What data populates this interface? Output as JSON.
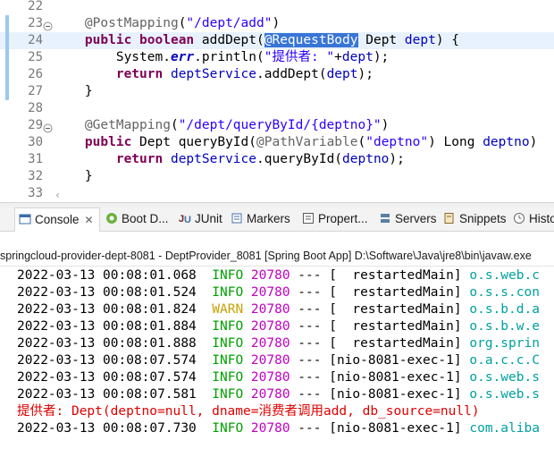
{
  "editor": {
    "lines": [
      {
        "num": "22",
        "tokens": []
      },
      {
        "num": "23",
        "fold": true,
        "tokens": [
          {
            "t": "    "
          },
          {
            "t": "@PostMapping",
            "c": "ann"
          },
          {
            "t": "("
          },
          {
            "t": "\"/dept/add\"",
            "c": "str"
          },
          {
            "t": ")"
          }
        ]
      },
      {
        "num": "24",
        "current": true,
        "tokens": [
          {
            "t": "    "
          },
          {
            "t": "public",
            "c": "kw"
          },
          {
            "t": " "
          },
          {
            "t": "boolean",
            "c": "kw"
          },
          {
            "t": " addDept("
          },
          {
            "t": "@RequestBody",
            "c": "sel"
          },
          {
            "t": " Dept "
          },
          {
            "t": "dept",
            "c": "fld"
          },
          {
            "t": ") {"
          }
        ]
      },
      {
        "num": "25",
        "tokens": [
          {
            "t": "        System."
          },
          {
            "t": "err",
            "c": "stat"
          },
          {
            "t": ".println("
          },
          {
            "t": "\"提供者: \"",
            "c": "str"
          },
          {
            "t": "+"
          },
          {
            "t": "dept",
            "c": "fld"
          },
          {
            "t": ");"
          }
        ]
      },
      {
        "num": "26",
        "tokens": [
          {
            "t": "        "
          },
          {
            "t": "return",
            "c": "kw"
          },
          {
            "t": " "
          },
          {
            "t": "deptService",
            "c": "fld"
          },
          {
            "t": ".addDept("
          },
          {
            "t": "dept",
            "c": "fld"
          },
          {
            "t": ");"
          }
        ]
      },
      {
        "num": "27",
        "tokens": [
          {
            "t": "    }"
          }
        ]
      },
      {
        "num": "28",
        "tokens": []
      },
      {
        "num": "29",
        "fold": true,
        "tokens": [
          {
            "t": "    "
          },
          {
            "t": "@GetMapping",
            "c": "ann"
          },
          {
            "t": "("
          },
          {
            "t": "\"/dept/queryById/{deptno}\"",
            "c": "str"
          },
          {
            "t": ")"
          }
        ]
      },
      {
        "num": "30",
        "tokens": [
          {
            "t": "    "
          },
          {
            "t": "public",
            "c": "kw"
          },
          {
            "t": " Dept queryById("
          },
          {
            "t": "@PathVariable",
            "c": "ann"
          },
          {
            "t": "("
          },
          {
            "t": "\"deptno\"",
            "c": "str"
          },
          {
            "t": ") Long "
          },
          {
            "t": "deptno",
            "c": "fld"
          },
          {
            "t": ")"
          }
        ]
      },
      {
        "num": "31",
        "tokens": [
          {
            "t": "        "
          },
          {
            "t": "return",
            "c": "kw"
          },
          {
            "t": " "
          },
          {
            "t": "deptService",
            "c": "fld"
          },
          {
            "t": ".queryById("
          },
          {
            "t": "deptno",
            "c": "fld"
          },
          {
            "t": ");"
          }
        ]
      },
      {
        "num": "32",
        "tokens": [
          {
            "t": "    }"
          }
        ]
      },
      {
        "num": "33",
        "tokens": []
      }
    ]
  },
  "tabs": [
    {
      "label": "Console",
      "icon": "console-icon",
      "color": "#3a6ea5",
      "active": true,
      "close": "✕"
    },
    {
      "label": "Boot D...",
      "icon": "spring-boot-icon",
      "color": "#6db33f"
    },
    {
      "label": "JUnit",
      "icon": "junit-icon",
      "color": "#7a1f1f"
    },
    {
      "label": "Markers",
      "icon": "markers-icon",
      "color": "#4a6fa5"
    },
    {
      "label": "Propert...",
      "icon": "properties-icon",
      "color": "#5a5a5a"
    },
    {
      "label": "Servers",
      "icon": "servers-icon",
      "color": "#5a7fa5"
    },
    {
      "label": "Snippets",
      "icon": "snippets-icon",
      "color": "#8a6a2a"
    },
    {
      "label": "Histo",
      "icon": "history-icon",
      "color": "#6a6a6a"
    }
  ],
  "console": {
    "header": "springcloud-provider-dept-8081 - DeptProvider_8081 [Spring Boot App] D:\\Software\\Java\\jre8\\bin\\javaw.exe",
    "lines": [
      {
        "tokens": [
          {
            "t": "2022-03-13 00:08:01.068  "
          },
          {
            "t": "INFO",
            "c": "info"
          },
          {
            "t": " "
          },
          {
            "t": "20780",
            "c": "pid"
          },
          {
            "t": " --- [  restartedMain] "
          },
          {
            "t": "o.s.web.c",
            "c": "logger"
          }
        ]
      },
      {
        "tokens": [
          {
            "t": "2022-03-13 00:08:01.524  "
          },
          {
            "t": "INFO",
            "c": "info"
          },
          {
            "t": " "
          },
          {
            "t": "20780",
            "c": "pid"
          },
          {
            "t": " --- [  restartedMain] "
          },
          {
            "t": "o.s.s.con",
            "c": "logger"
          }
        ]
      },
      {
        "tokens": [
          {
            "t": "2022-03-13 00:08:01.824  "
          },
          {
            "t": "WARN",
            "c": "warn"
          },
          {
            "t": " "
          },
          {
            "t": "20780",
            "c": "pid"
          },
          {
            "t": " --- [  restartedMain] "
          },
          {
            "t": "o.s.b.d.a",
            "c": "logger"
          }
        ]
      },
      {
        "tokens": [
          {
            "t": "2022-03-13 00:08:01.884  "
          },
          {
            "t": "INFO",
            "c": "info"
          },
          {
            "t": " "
          },
          {
            "t": "20780",
            "c": "pid"
          },
          {
            "t": " --- [  restartedMain] "
          },
          {
            "t": "o.s.b.w.e",
            "c": "logger"
          }
        ]
      },
      {
        "tokens": [
          {
            "t": "2022-03-13 00:08:01.888  "
          },
          {
            "t": "INFO",
            "c": "info"
          },
          {
            "t": " "
          },
          {
            "t": "20780",
            "c": "pid"
          },
          {
            "t": " --- [  restartedMain] "
          },
          {
            "t": "org.sprin",
            "c": "logger"
          }
        ]
      },
      {
        "tokens": [
          {
            "t": "2022-03-13 00:08:07.574  "
          },
          {
            "t": "INFO",
            "c": "info"
          },
          {
            "t": " "
          },
          {
            "t": "20780",
            "c": "pid"
          },
          {
            "t": " --- [nio-8081-exec-1] "
          },
          {
            "t": "o.a.c.c.C",
            "c": "logger"
          }
        ]
      },
      {
        "tokens": [
          {
            "t": "2022-03-13 00:08:07.574  "
          },
          {
            "t": "INFO",
            "c": "info"
          },
          {
            "t": " "
          },
          {
            "t": "20780",
            "c": "pid"
          },
          {
            "t": " --- [nio-8081-exec-1] "
          },
          {
            "t": "o.s.web.s",
            "c": "logger"
          }
        ]
      },
      {
        "tokens": [
          {
            "t": "2022-03-13 00:08:07.581  "
          },
          {
            "t": "INFO",
            "c": "info"
          },
          {
            "t": " "
          },
          {
            "t": "20780",
            "c": "pid"
          },
          {
            "t": " --- [nio-8081-exec-1] "
          },
          {
            "t": "o.s.web.s",
            "c": "logger"
          }
        ]
      },
      {
        "tokens": [
          {
            "t": "提供者: Dept(deptno=null, dname=消费者调用add, db_source=null)",
            "c": "err"
          }
        ]
      },
      {
        "tokens": [
          {
            "t": "2022-03-13 00:08:07.730  "
          },
          {
            "t": "INFO",
            "c": "info"
          },
          {
            "t": " "
          },
          {
            "t": "20780",
            "c": "pid"
          },
          {
            "t": " --- [nio-8081-exec-1] "
          },
          {
            "t": "com.aliba",
            "c": "logger"
          }
        ]
      }
    ]
  }
}
